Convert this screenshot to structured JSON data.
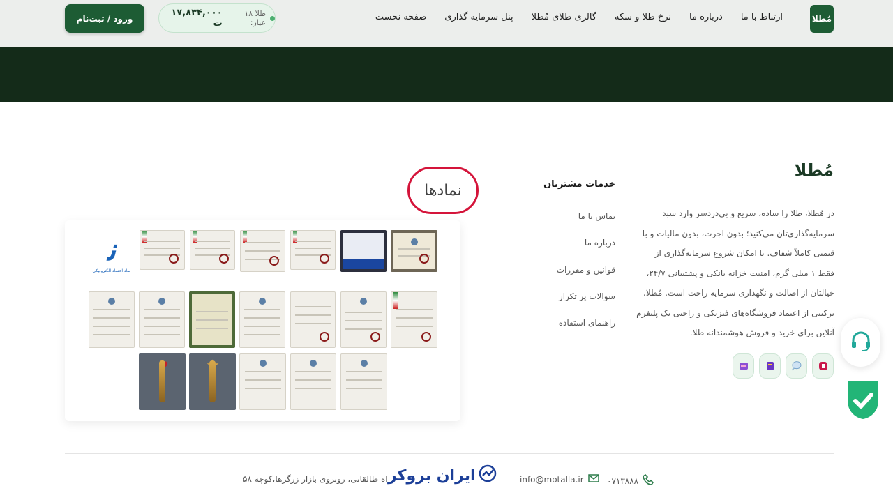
{
  "header": {
    "logo_text": "مُطلا",
    "nav": [
      {
        "label": "صفحه نخست"
      },
      {
        "label": "پنل سرمایه گذاری"
      },
      {
        "label": "گالری طلای مُطلا"
      },
      {
        "label": "نرخ طلا و سکه"
      },
      {
        "label": "درباره ما"
      },
      {
        "label": "ارتباط با ما"
      }
    ],
    "price_label": "طلا ۱۸ عیار:",
    "price_value": "۱۷,۸۳۴,۰۰۰ ت",
    "login_label": "ورود / ثبت‌نام"
  },
  "brand": {
    "title": "مُطلا",
    "description": "در مُطلا، طلا را ساده، سریع و بی‌دردسر وارد سبد سرمایه‌گذاری‌تان می‌کنید؛ بدون اجرت، بدون مالیات و با قیمتی کاملاً شفاف. با امکان شروع سرمایه‌گذاری از فقط ۱ میلی گرم، امنیت خزانه بانکی و پشتیبانی ۲۴/۷، خیالتان از اصالت و نگهداری سرمایه راحت است. مُطلا، ترکیبی از اعتماد فروشگاه‌های فیزیکی و راحتی یک پلتفرم آنلاین برای خرید و فروش هوشمندانه طلا."
  },
  "services": {
    "title": "خدمات مشتریان",
    "items": [
      {
        "label": "تماس با ما"
      },
      {
        "label": "درباره ما"
      },
      {
        "label": "قوانین و مقررات"
      },
      {
        "label": "سوالات پر تکرار"
      },
      {
        "label": "راهنمای استفاده"
      }
    ]
  },
  "certificates": {
    "title": "نمادها",
    "enamad_caption": "نماد اعتماد الکترونیکی"
  },
  "footer": {
    "phone": "۰۷۱۳۸۸۸",
    "email": "info@motalla.ir",
    "brand": "ایران بروکر",
    "address": "اه طالقانی، روبروی بازار زرگرها،کوچه ۵۸"
  },
  "colors": {
    "primary_green": "#1d5c34",
    "hero_dark": "#142b19",
    "highlight_red": "#d4143a",
    "footer_brand_blue": "#1c3f98"
  }
}
